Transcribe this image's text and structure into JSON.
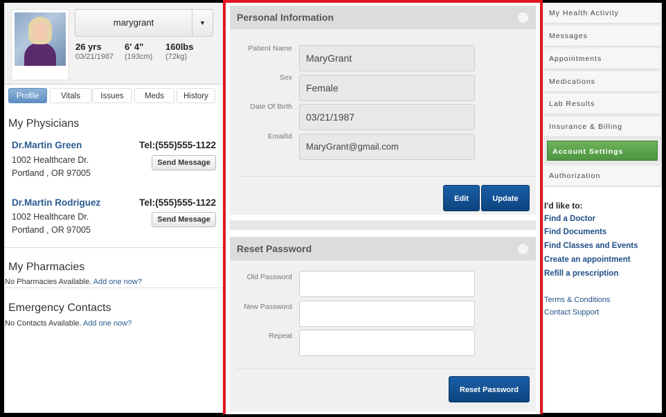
{
  "profile": {
    "username": "marygrant",
    "stats": [
      {
        "big": "26 yrs",
        "small": "03/21/1987"
      },
      {
        "big": "6' 4\"",
        "small": "(193cm)"
      },
      {
        "big": "160lbs",
        "small": "(72kg)"
      }
    ],
    "tabs": [
      "Profile",
      "Vitals",
      "Issues",
      "Meds",
      "History"
    ],
    "active_tab": "Profile"
  },
  "physicians": {
    "title": "My Physicians",
    "items": [
      {
        "name": "Dr.Martin Green",
        "tel": "Tel:(555)555-1122",
        "addr1": "1002 Healthcare Dr.",
        "addr2": "Portland , OR 97005",
        "button": "Send Message"
      },
      {
        "name": "Dr.Martin Rodriguez",
        "tel": "Tel:(555)555-1122",
        "addr1": "1002 Healthcare Dr.",
        "addr2": "Portland , OR 97005",
        "button": "Send Message"
      }
    ]
  },
  "pharmacies": {
    "title": "My Pharmacies",
    "empty_text": "No Pharmacies Available.",
    "add_link": "Add one now?"
  },
  "emergency": {
    "title": "Emergency Contacts",
    "empty_text": "No Contacts Available.",
    "add_link": "Add one now?"
  },
  "personal_info": {
    "title": "Personal Information",
    "fields": [
      {
        "label": "Patient Name",
        "value": "MaryGrant"
      },
      {
        "label": "Sex",
        "value": "Female"
      },
      {
        "label": "Date Of Birth",
        "value": "03/21/1987"
      },
      {
        "label": "EmailId",
        "value": "MaryGrant@gmail.com"
      }
    ],
    "edit_label": "Edit",
    "update_label": "Update"
  },
  "reset_password": {
    "title": "Reset Password",
    "fields": [
      {
        "label": "Old Password",
        "value": ""
      },
      {
        "label": "New Password",
        "value": ""
      },
      {
        "label": "Repeat",
        "value": ""
      }
    ],
    "button_label": "Reset Password"
  },
  "sidebar": {
    "items": [
      "My Health Activity",
      "Messages",
      "Appointments",
      "Medications",
      "Lab Results",
      "Insurance & Billing",
      "Account Settings",
      "Authorization"
    ],
    "active": "Account Settings",
    "like_title": "I'd like to:",
    "like_links": [
      "Find a Doctor",
      "Find Documents",
      "Find Classes and Events",
      "Create an appointment",
      "Refill a prescription"
    ],
    "footer_links": [
      "Terms & Conditions",
      "Contact Support"
    ]
  },
  "colors": {
    "accent_red": "#e0151f",
    "nav_active": "#5ca34d",
    "button_blue": "#0d447f",
    "link": "#1f4e86"
  }
}
